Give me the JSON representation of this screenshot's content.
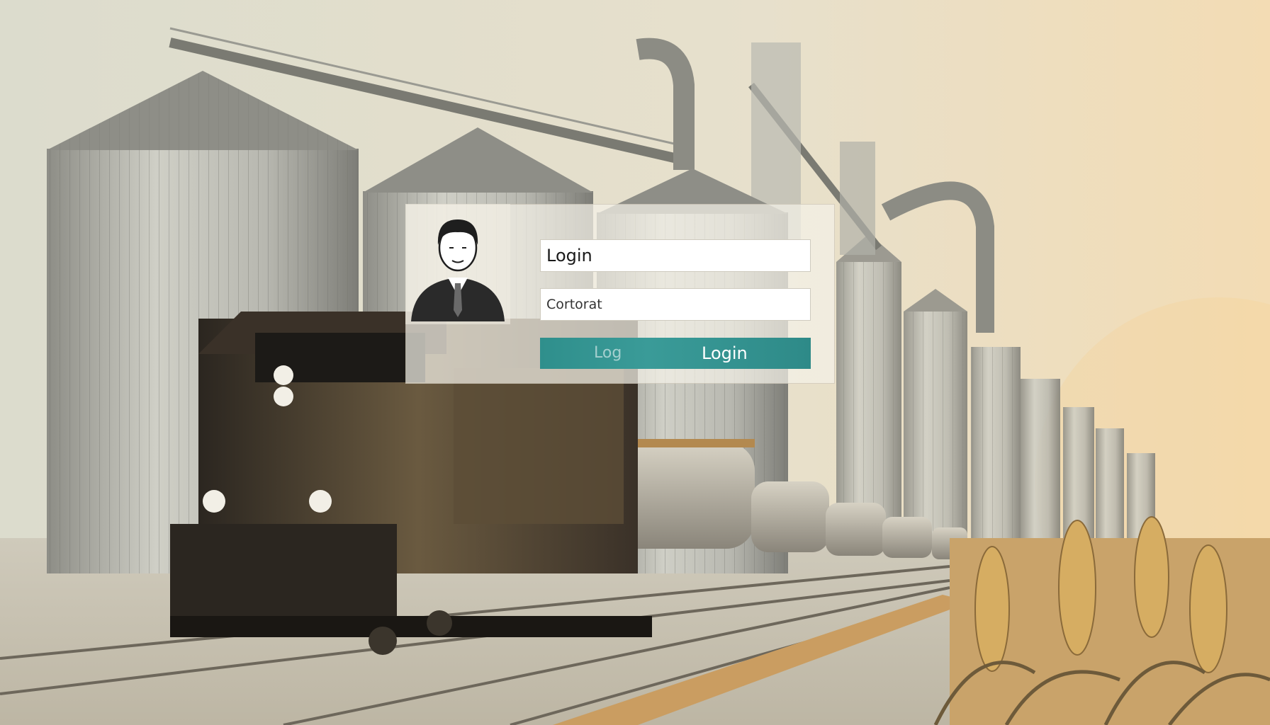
{
  "login_form": {
    "username_value": "Login",
    "password_value": "Cortorat",
    "button_ghost_text": "Log",
    "button_label": "Login"
  },
  "colors": {
    "button": "#2f8f8c",
    "background": "#e6e2d2",
    "field": "#ffffff"
  },
  "icons": [
    "user-avatar-icon"
  ]
}
